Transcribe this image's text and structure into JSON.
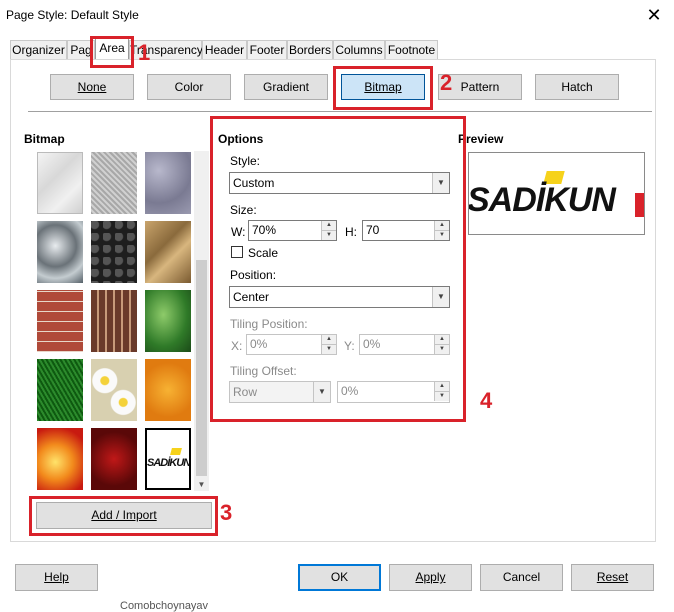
{
  "window": {
    "title": "Page Style: Default Style",
    "close_glyph": "✕"
  },
  "tabs": [
    {
      "label": "Organizer"
    },
    {
      "label": "Pag"
    },
    {
      "label": "Area"
    },
    {
      "label": "Transparency"
    },
    {
      "label": "Header"
    },
    {
      "label": "Footer"
    },
    {
      "label": "Borders"
    },
    {
      "label": "Columns"
    },
    {
      "label": "Footnote"
    }
  ],
  "fill_buttons": [
    {
      "label": "None"
    },
    {
      "label": "Color"
    },
    {
      "label": "Gradient"
    },
    {
      "label": "Bitmap"
    },
    {
      "label": "Pattern"
    },
    {
      "label": "Hatch"
    }
  ],
  "bitmap": {
    "heading": "Bitmap",
    "add_import_label": "Add / Import",
    "thumbnails": [
      {
        "name": "painted-white"
      },
      {
        "name": "paper-texture"
      },
      {
        "name": "paper-crumpled"
      },
      {
        "name": "metal"
      },
      {
        "name": "pebbles"
      },
      {
        "name": "stone"
      },
      {
        "name": "brick"
      },
      {
        "name": "wood-floor"
      },
      {
        "name": "leaves"
      },
      {
        "name": "grass"
      },
      {
        "name": "daisy"
      },
      {
        "name": "orange-texture"
      },
      {
        "name": "fire"
      },
      {
        "name": "roses"
      },
      {
        "name": "sadikun-logo"
      }
    ],
    "logo_text": "SADİKUN"
  },
  "options": {
    "heading": "Options",
    "style_label": "Style:",
    "style_value": "Custom",
    "size_label": "Size:",
    "w_label": "W:",
    "w_value": "70%",
    "h_label": "H:",
    "h_value": "70",
    "scale_label": "Scale",
    "position_label": "Position:",
    "position_value": "Center",
    "tiling_position_label": "Tiling Position:",
    "x_label": "X:",
    "x_value": "0%",
    "y_label": "Y:",
    "y_value": "0%",
    "tiling_offset_label": "Tiling Offset:",
    "offset_type_value": "Row",
    "offset_value": "0%"
  },
  "preview": {
    "heading": "Preview",
    "logo_text": "SADİKUN"
  },
  "footer_buttons": {
    "help": "Help",
    "ok": "OK",
    "apply": "Apply",
    "cancel": "Cancel",
    "reset": "Reset"
  },
  "annotations": [
    {
      "number": "1"
    },
    {
      "number": "2"
    },
    {
      "number": "3"
    },
    {
      "number": "4"
    }
  ],
  "background_text": "Comobchoynayav",
  "colors": {
    "annotation_red": "#d9222a",
    "selected_blue": "#cce4f7"
  }
}
